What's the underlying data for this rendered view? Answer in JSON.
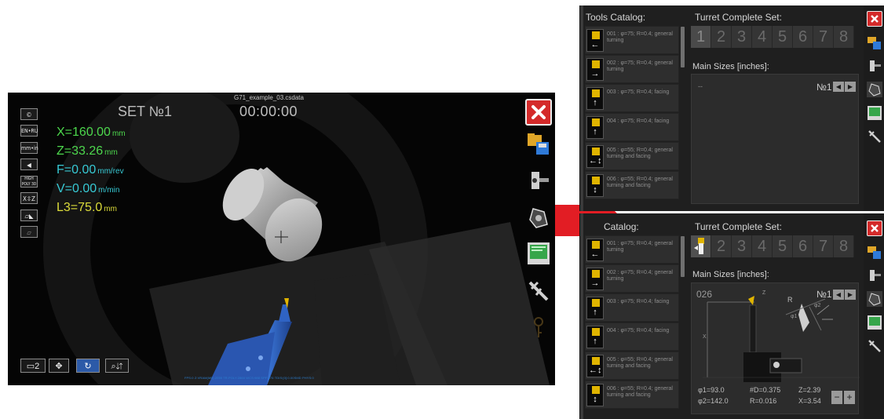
{
  "simulator": {
    "file_title": "G71_example_03.csdata",
    "set_label": "SET №1",
    "timer": "00:00:00",
    "left_buttons": [
      "©",
      "EN•RU",
      "mm•in",
      "◀",
      "HIGH POLY 3D",
      "X⇳Z",
      "▱◣",
      "▱"
    ],
    "coords": {
      "x": {
        "label": "X=160.00",
        "unit": "mm"
      },
      "z": {
        "label": "Z=33.26",
        "unit": "mm"
      },
      "f": {
        "label": "F=0.00",
        "unit": "mm/rev"
      },
      "v": {
        "label": "V=0.00",
        "unit": "m/min"
      },
      "l3": {
        "label": "L3=75.0",
        "unit": "mm"
      }
    },
    "bottom_buttons": [
      "▭2",
      "✥",
      "↻",
      "⌕⇵"
    ],
    "fps_text": "FPS:0  Z:VRAM(MB):2055  TR.POLY:2860  WCS:988  SPF:376  TDIS:[0]:0.00SMD  PHYS:0",
    "right_icons": [
      "close-icon",
      "folder-save-icon",
      "tool-holder-icon",
      "turret-icon",
      "cnc-screen-icon",
      "caliper-icon"
    ]
  },
  "colors": {
    "coord_green": "#4dd84d",
    "coord_cyan": "#37c9d4",
    "coord_yellow": "#dcdc3a",
    "close_red": "#d42a2a",
    "arrow_red": "#e21d24",
    "tool_yellow": "#e0b400",
    "tool_blue": "#2f63c4"
  },
  "panel_top": {
    "catalog_title": "Tools Catalog:",
    "turret_title": "Turret Complete Set:",
    "tabs": [
      "1",
      "2",
      "3",
      "4",
      "5",
      "6",
      "7",
      "8"
    ],
    "main_sizes_title": "Main Sizes [inches]:",
    "placeholder": "--",
    "number": "№1",
    "catalog_items": [
      {
        "text": "001 : φ=75; R=0.4; general turning",
        "arrow": "←"
      },
      {
        "text": "002 : φ=75; R=0.4; general turning",
        "arrow": "→"
      },
      {
        "text": "003 : φ=75; R=0.4; facing",
        "arrow": "↑"
      },
      {
        "text": "004 : φ=75; R=0.4; facing",
        "arrow": "↑"
      },
      {
        "text": "005 : φ=55; R=0.4; general turning and facing",
        "arrow": "←↕"
      },
      {
        "text": "006 : φ=55; R=0.4; general turning and facing",
        "arrow": "↕"
      }
    ]
  },
  "panel_bottom": {
    "catalog_title": "Catalog:",
    "turret_title": "Turret Complete Set:",
    "tabs": [
      "",
      "2",
      "3",
      "4",
      "5",
      "6",
      "7",
      "8"
    ],
    "main_sizes_title": "Main Sizes [inches]:",
    "tool_code": "026",
    "number": "№1",
    "drawing_labels": [
      "Z",
      "X",
      "R",
      "φ1",
      "φ2"
    ],
    "values": {
      "phi1": "φ1=93.0",
      "phi2": "φ2=142.0",
      "d": "#D=0.375",
      "r": "R=0.016",
      "z": "Z=2.39",
      "x": "X=3.54"
    },
    "minus": "−",
    "plus": "+",
    "catalog_items": [
      {
        "text": "001 : φ=75; R=0.4; general turning",
        "arrow": "←"
      },
      {
        "text": "002 : φ=75; R=0.4; general turning",
        "arrow": "→"
      },
      {
        "text": "003 : φ=75; R=0.4; facing",
        "arrow": "↑"
      },
      {
        "text": "004 : φ=75; R=0.4; facing",
        "arrow": "↑"
      },
      {
        "text": "005 : φ=55; R=0.4; general turning and facing",
        "arrow": "←↕"
      },
      {
        "text": "006 : φ=55; R=0.4; general turning and facing",
        "arrow": "↕"
      }
    ]
  }
}
